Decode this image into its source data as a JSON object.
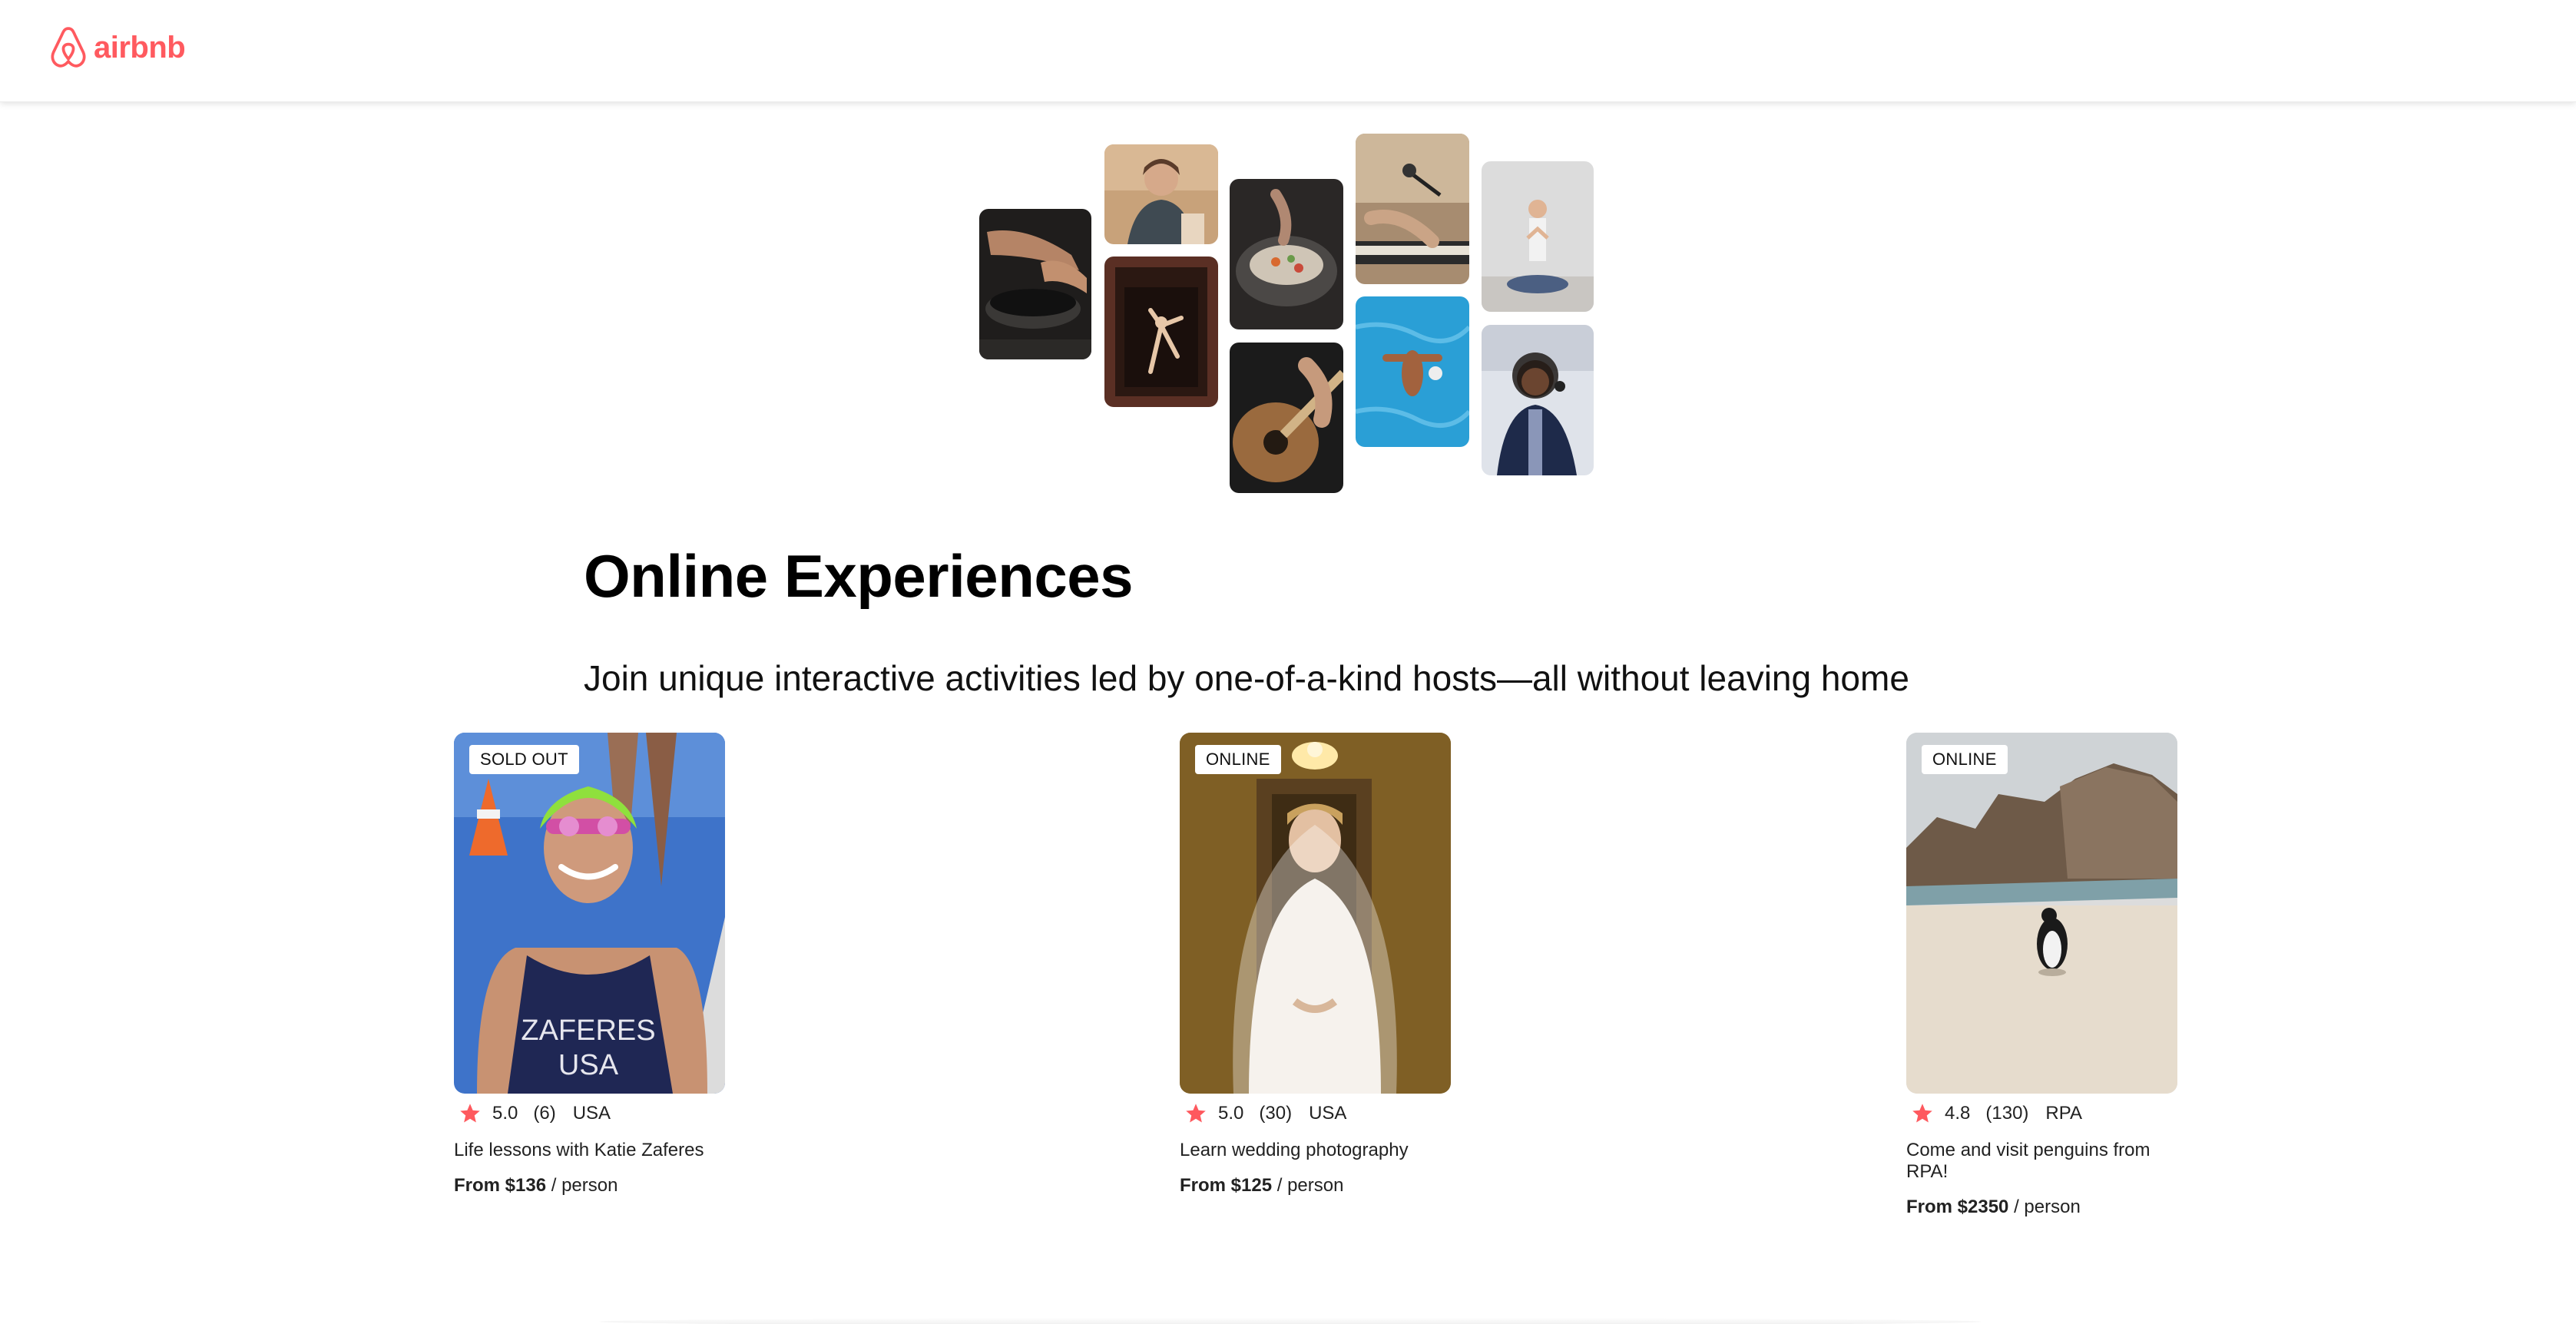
{
  "header": {
    "logo_text": "airbnb",
    "brand_color": "#FF5A5F"
  },
  "hero": {
    "title": "Online Experiences",
    "subtitle": "Join unique interactive activities led by one-of-a-kind hosts—all without leaving home"
  },
  "experiences": [
    {
      "badge": "SOLD OUT",
      "rating": "5.0",
      "reviews": "(6)",
      "location": "USA",
      "title": "Life lessons with Katie Zaferes",
      "price_label": "From $136",
      "price_unit": " / person"
    },
    {
      "badge": "ONLINE",
      "rating": "5.0",
      "reviews": "(30)",
      "location": "USA",
      "title": "Learn wedding photography",
      "price_label": "From $125",
      "price_unit": " / person"
    },
    {
      "badge": "ONLINE",
      "rating": "4.8",
      "reviews": "(130)",
      "location": "RPA",
      "title": "Come and visit penguins from RPA!",
      "price_label": "From $2350",
      "price_unit": " / person"
    }
  ],
  "icons": {
    "logo": "airbnb-belo-icon",
    "rating": "star-icon"
  },
  "colors": {
    "star": "#FE595E",
    "text": "#222222"
  }
}
